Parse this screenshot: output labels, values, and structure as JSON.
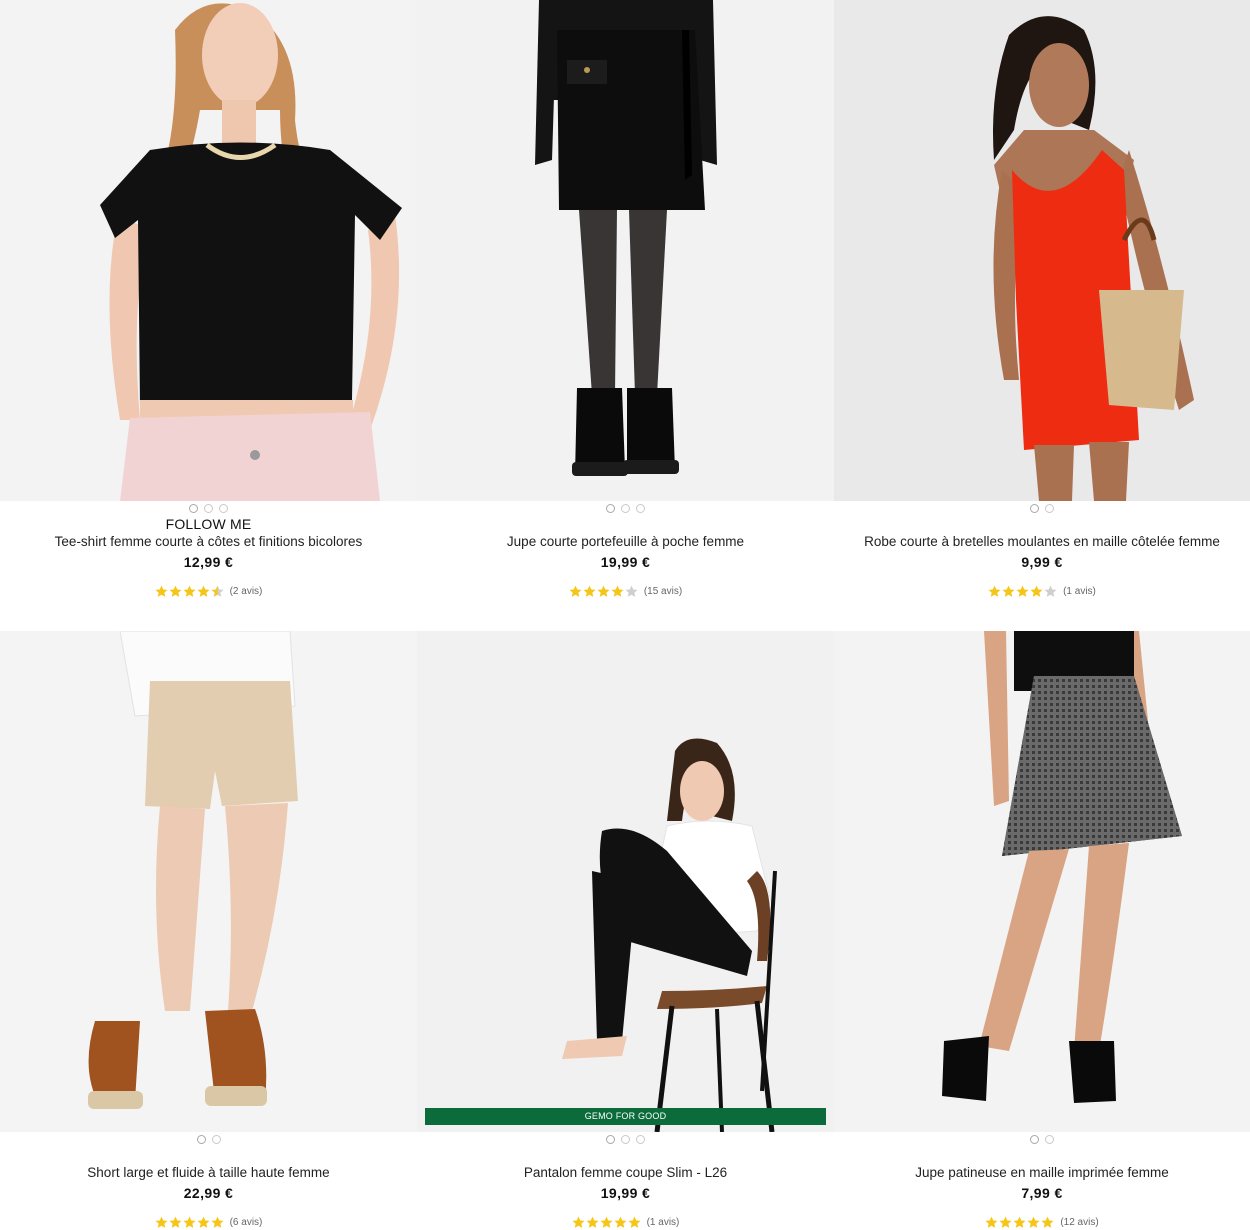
{
  "colors": {
    "star_filled": "#f5c518",
    "star_empty": "#cfcfcf",
    "badge_green": "#0b6b3a"
  },
  "products": [
    {
      "brand": "FOLLOW ME",
      "name": "Tee-shirt femme courte à côtes et finitions bicolores",
      "price": "12,99 €",
      "rating": 4.5,
      "reviews": "(2 avis)",
      "image_dots": 3,
      "active_dot": 0
    },
    {
      "brand": "",
      "name": "Jupe courte portefeuille à poche femme",
      "price": "19,99 €",
      "rating": 4,
      "reviews": "(15 avis)",
      "image_dots": 3,
      "active_dot": 0
    },
    {
      "brand": "",
      "name": "Robe courte à bretelles moulantes en maille côtelée femme",
      "price": "9,99 €",
      "rating": 4,
      "reviews": "(1 avis)",
      "image_dots": 2,
      "active_dot": 0
    },
    {
      "brand": "",
      "name": "Short large et fluide à taille haute femme",
      "price": "22,99 €",
      "rating": 5,
      "reviews": "(6 avis)",
      "image_dots": 2,
      "active_dot": 0
    },
    {
      "brand": "",
      "name": "Pantalon femme coupe Slim - L26",
      "price": "19,99 €",
      "rating": 5,
      "reviews": "(1 avis)",
      "image_dots": 3,
      "active_dot": 0,
      "badge": "GEMO FOR GOOD"
    },
    {
      "brand": "",
      "name": "Jupe patineuse en maille imprimée femme",
      "price": "7,99 €",
      "rating": 5,
      "reviews": "(12 avis)",
      "image_dots": 2,
      "active_dot": 0
    }
  ]
}
